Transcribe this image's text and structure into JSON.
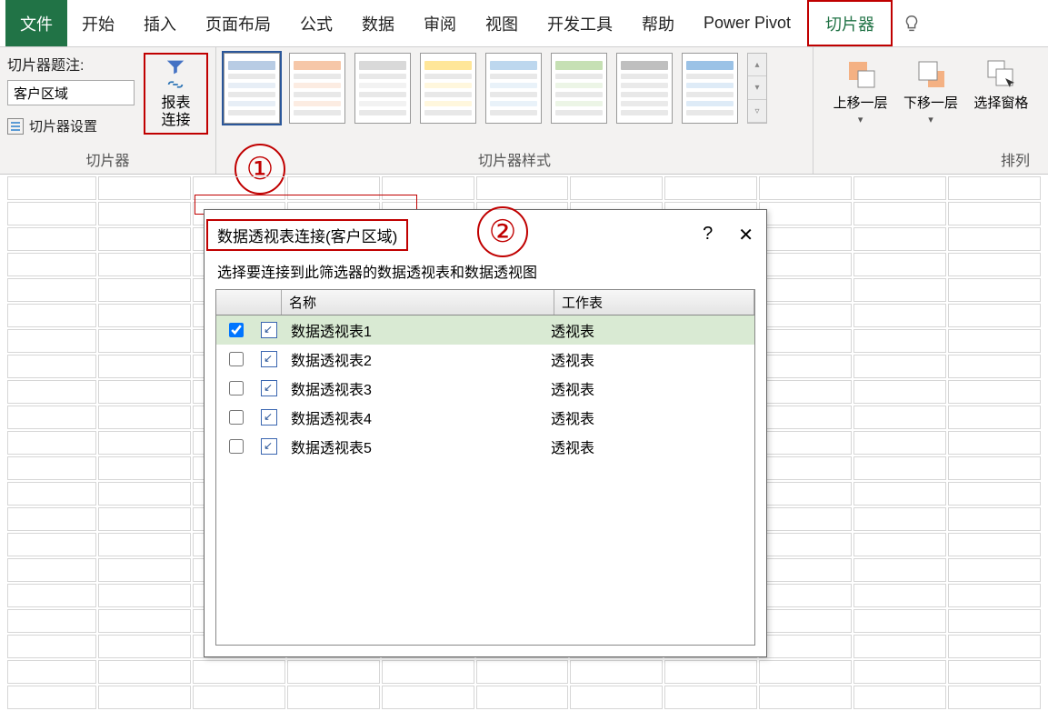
{
  "menu": {
    "tabs": [
      "文件",
      "开始",
      "插入",
      "页面布局",
      "公式",
      "数据",
      "审阅",
      "视图",
      "开发工具",
      "帮助",
      "Power Pivot"
    ],
    "slicer_tab": "切片器"
  },
  "ribbon": {
    "caption_label": "切片器题注:",
    "caption_value": "客户区域",
    "settings_label": "切片器设置",
    "report_conn_l1": "报表",
    "report_conn_l2": "连接",
    "group_slicer": "切片器",
    "group_styles": "切片器样式",
    "group_arrange": "排列",
    "bring_forward": "上移一层",
    "send_backward": "下移一层",
    "selection_pane": "选择窗格",
    "style_colors": [
      "#b8cce4",
      "#f6c7a8",
      "#d9d9d9",
      "#ffe699",
      "#bdd7ee",
      "#c6e0b4",
      "#bfbfbf",
      "#9bc2e6"
    ]
  },
  "callouts": {
    "one": "①",
    "two": "②"
  },
  "dialog": {
    "title": "数据透视表连接(客户区域)",
    "subtitle": "选择要连接到此筛选器的数据透视表和数据透视图",
    "help": "?",
    "close": "✕",
    "col_name": "名称",
    "col_sheet": "工作表",
    "rows": [
      {
        "checked": true,
        "name": "数据透视表1",
        "sheet": "透视表"
      },
      {
        "checked": false,
        "name": "数据透视表2",
        "sheet": "透视表"
      },
      {
        "checked": false,
        "name": "数据透视表3",
        "sheet": "透视表"
      },
      {
        "checked": false,
        "name": "数据透视表4",
        "sheet": "透视表"
      },
      {
        "checked": false,
        "name": "数据透视表5",
        "sheet": "透视表"
      }
    ]
  }
}
